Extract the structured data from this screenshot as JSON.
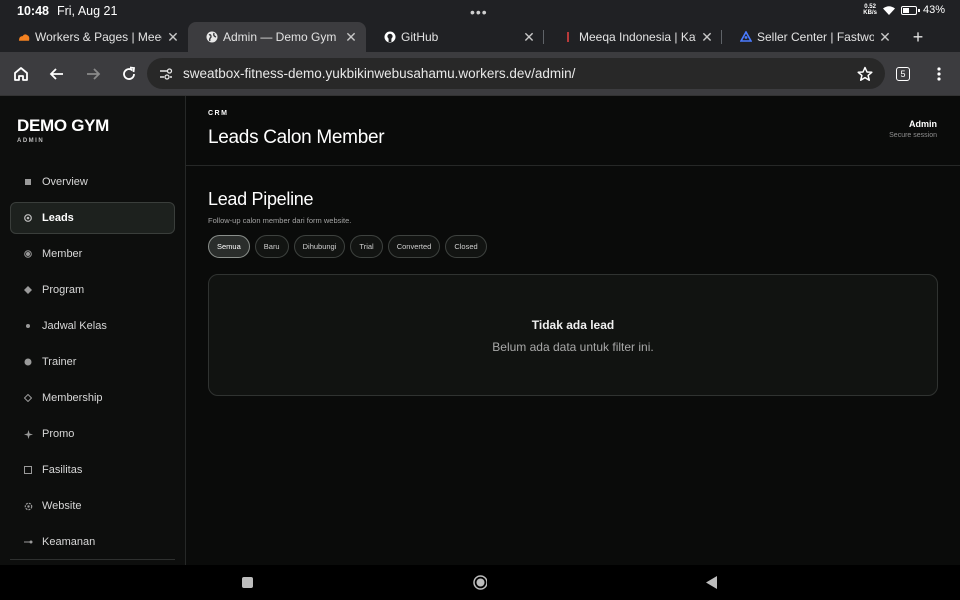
{
  "status_bar": {
    "time": "10:48",
    "date": "Fri, Aug 21",
    "net_speed_value": "0.52",
    "net_speed_unit": "KB/s",
    "battery": "43%",
    "battery_level": 0.43
  },
  "tabs": [
    {
      "label": "Workers & Pages | Meeqa.ir",
      "icon": "cloudflare-icon",
      "active": false
    },
    {
      "label": "Admin — Demo Gym",
      "icon": "globe-icon",
      "active": true
    },
    {
      "label": "GitHub",
      "icon": "github-icon",
      "active": false
    },
    {
      "label": "Meeqa Indonesia | Katalog",
      "icon": "meeqa-icon",
      "active": false
    },
    {
      "label": "Seller Center | Fastwork.id",
      "icon": "fastwork-icon",
      "active": false
    }
  ],
  "toolbar": {
    "url": "sweatbox-fitness-demo.yukbikinwebusahamu.workers.dev/admin/",
    "tab_count": "5"
  },
  "sidebar": {
    "brand": "DEMO GYM",
    "brand_sub": "ADMIN",
    "items": [
      {
        "label": "Overview",
        "icon": "square-icon",
        "active": false
      },
      {
        "label": "Leads",
        "icon": "target-icon",
        "active": true
      },
      {
        "label": "Member",
        "icon": "ring-icon",
        "active": false
      },
      {
        "label": "Program",
        "icon": "diamond-icon",
        "active": false
      },
      {
        "label": "Jadwal Kelas",
        "icon": "dot-icon",
        "active": false
      },
      {
        "label": "Trainer",
        "icon": "circle-icon",
        "active": false
      },
      {
        "label": "Membership",
        "icon": "diamond-outline-icon",
        "active": false
      },
      {
        "label": "Promo",
        "icon": "sparkle-icon",
        "active": false
      },
      {
        "label": "Fasilitas",
        "icon": "square-outline-icon",
        "active": false
      },
      {
        "label": "Website",
        "icon": "gear-icon",
        "active": false
      },
      {
        "label": "Keamanan",
        "icon": "key-icon",
        "active": false
      }
    ]
  },
  "header": {
    "crumb": "CRM",
    "title": "Leads Calon Member",
    "user_name": "Admin",
    "user_session": "Secure session"
  },
  "section": {
    "title": "Lead Pipeline",
    "description": "Follow-up calon member dari form website.",
    "filters": [
      "Semua",
      "Baru",
      "Dihubungi",
      "Trial",
      "Converted",
      "Closed"
    ],
    "active_filter": "Semua"
  },
  "empty_state": {
    "title": "Tidak ada lead",
    "message": "Belum ada data untuk filter ini."
  },
  "colors": {
    "background": "#0a0b0a",
    "sidebar": "#0d0e0d",
    "browser_chrome": "#3c3c3f"
  }
}
